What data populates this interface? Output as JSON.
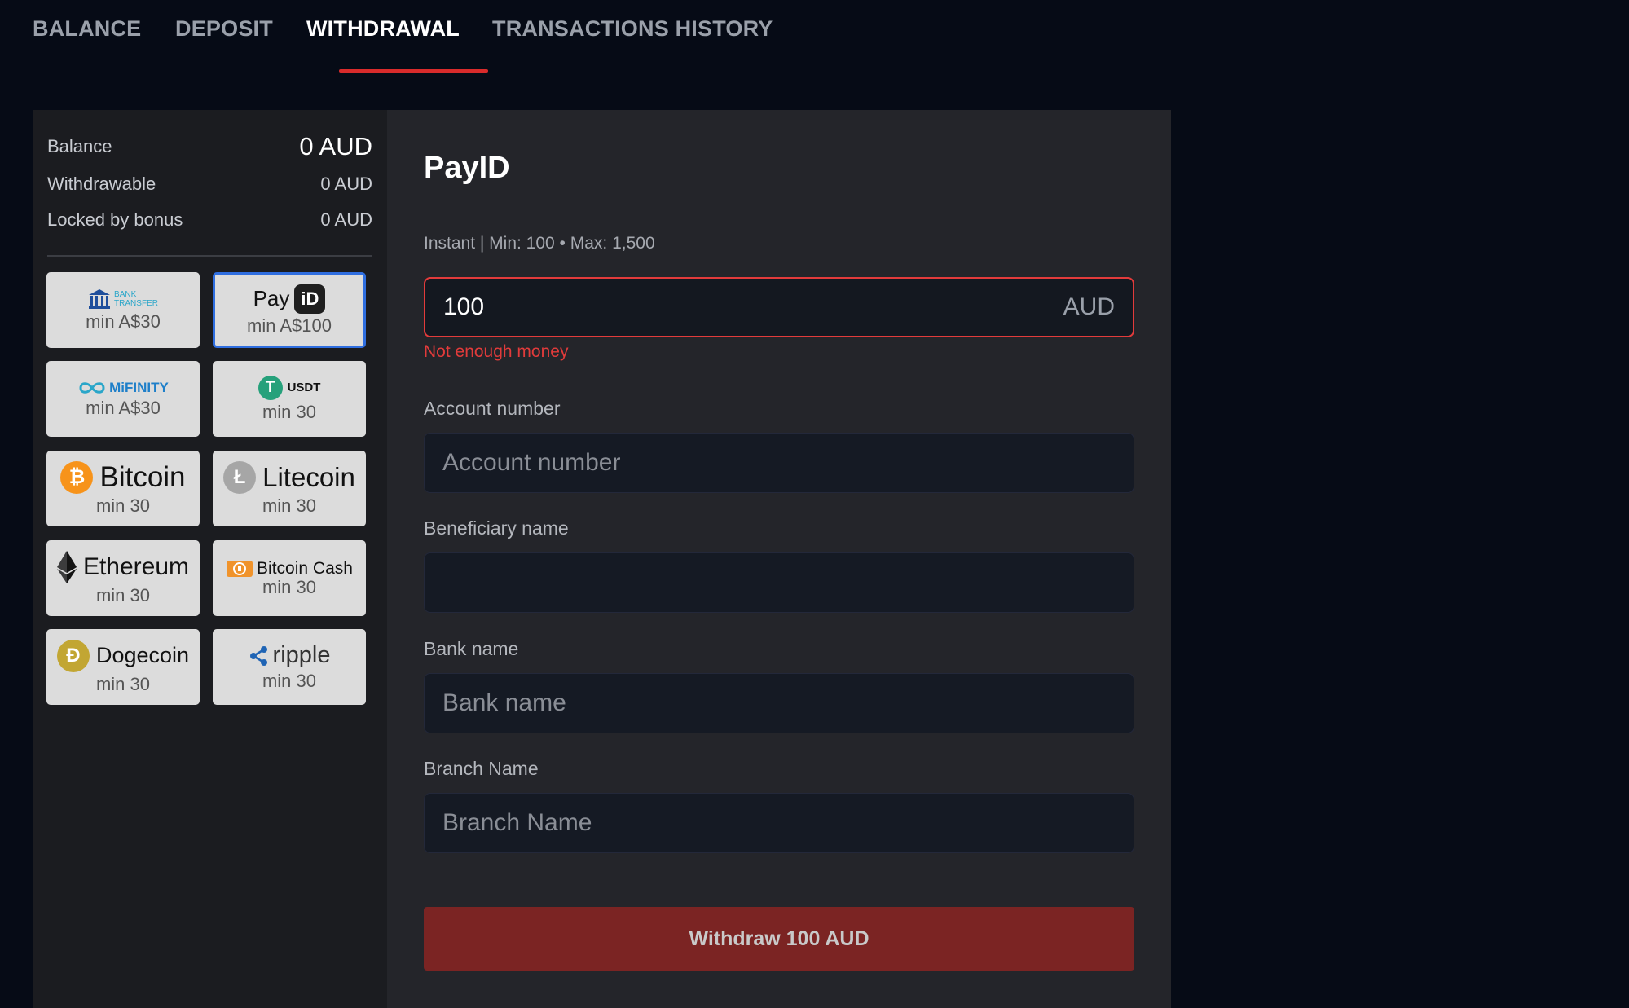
{
  "tabs": [
    {
      "label": "BALANCE"
    },
    {
      "label": "DEPOSIT"
    },
    {
      "label": "WITHDRAWAL"
    },
    {
      "label": "TRANSACTIONS HISTORY"
    }
  ],
  "active_tab": "WITHDRAWAL",
  "balance": {
    "balance_label": "Balance",
    "balance_value": "0 AUD",
    "withdrawable_label": "Withdrawable",
    "withdrawable_value": "0 AUD",
    "locked_label": "Locked by bonus",
    "locked_value": "0 AUD"
  },
  "methods": [
    {
      "name": "bank-transfer",
      "logo_line1": "BANK",
      "logo_line2": "TRANSFER",
      "min": "min A$30"
    },
    {
      "name": "payid",
      "logo_text": "Pay",
      "logo_badge": "iD",
      "min": "min A$100",
      "selected": true
    },
    {
      "name": "mifinity",
      "logo_text": "MiFINITY",
      "min": "min A$30"
    },
    {
      "name": "usdt",
      "logo_text": "USDT",
      "logo_symbol": "T",
      "min": "min 30"
    },
    {
      "name": "bitcoin",
      "logo_text": "Bitcoin",
      "logo_symbol": "₿",
      "min": "min 30"
    },
    {
      "name": "litecoin",
      "logo_text": "Litecoin",
      "logo_symbol": "Ł",
      "min": "min 30"
    },
    {
      "name": "ethereum",
      "logo_text": "Ethereum",
      "min": "min 30"
    },
    {
      "name": "bitcoin-cash",
      "logo_text": "Bitcoin Cash",
      "min": "min 30"
    },
    {
      "name": "dogecoin",
      "logo_text": "Dogecoin",
      "logo_symbol": "Ð",
      "min": "min 30"
    },
    {
      "name": "ripple",
      "logo_text": "ripple",
      "min": "min 30"
    }
  ],
  "form": {
    "title": "PayID",
    "info": "Instant | Min: 100 • Max: 1,500",
    "amount_value": "100",
    "amount_currency": "AUD",
    "error": "Not enough money",
    "account_label": "Account number",
    "account_placeholder": "Account number",
    "beneficiary_label": "Beneficiary name",
    "beneficiary_placeholder": "",
    "bank_label": "Bank name",
    "bank_placeholder": "Bank name",
    "branch_label": "Branch Name",
    "branch_placeholder": "Branch Name",
    "submit_label": "Withdraw 100 AUD"
  },
  "colors": {
    "accent_red": "#d92b2b",
    "error_red": "#e23b3b",
    "selected_blue": "#2f6ee0",
    "button_red": "#7b2423"
  }
}
